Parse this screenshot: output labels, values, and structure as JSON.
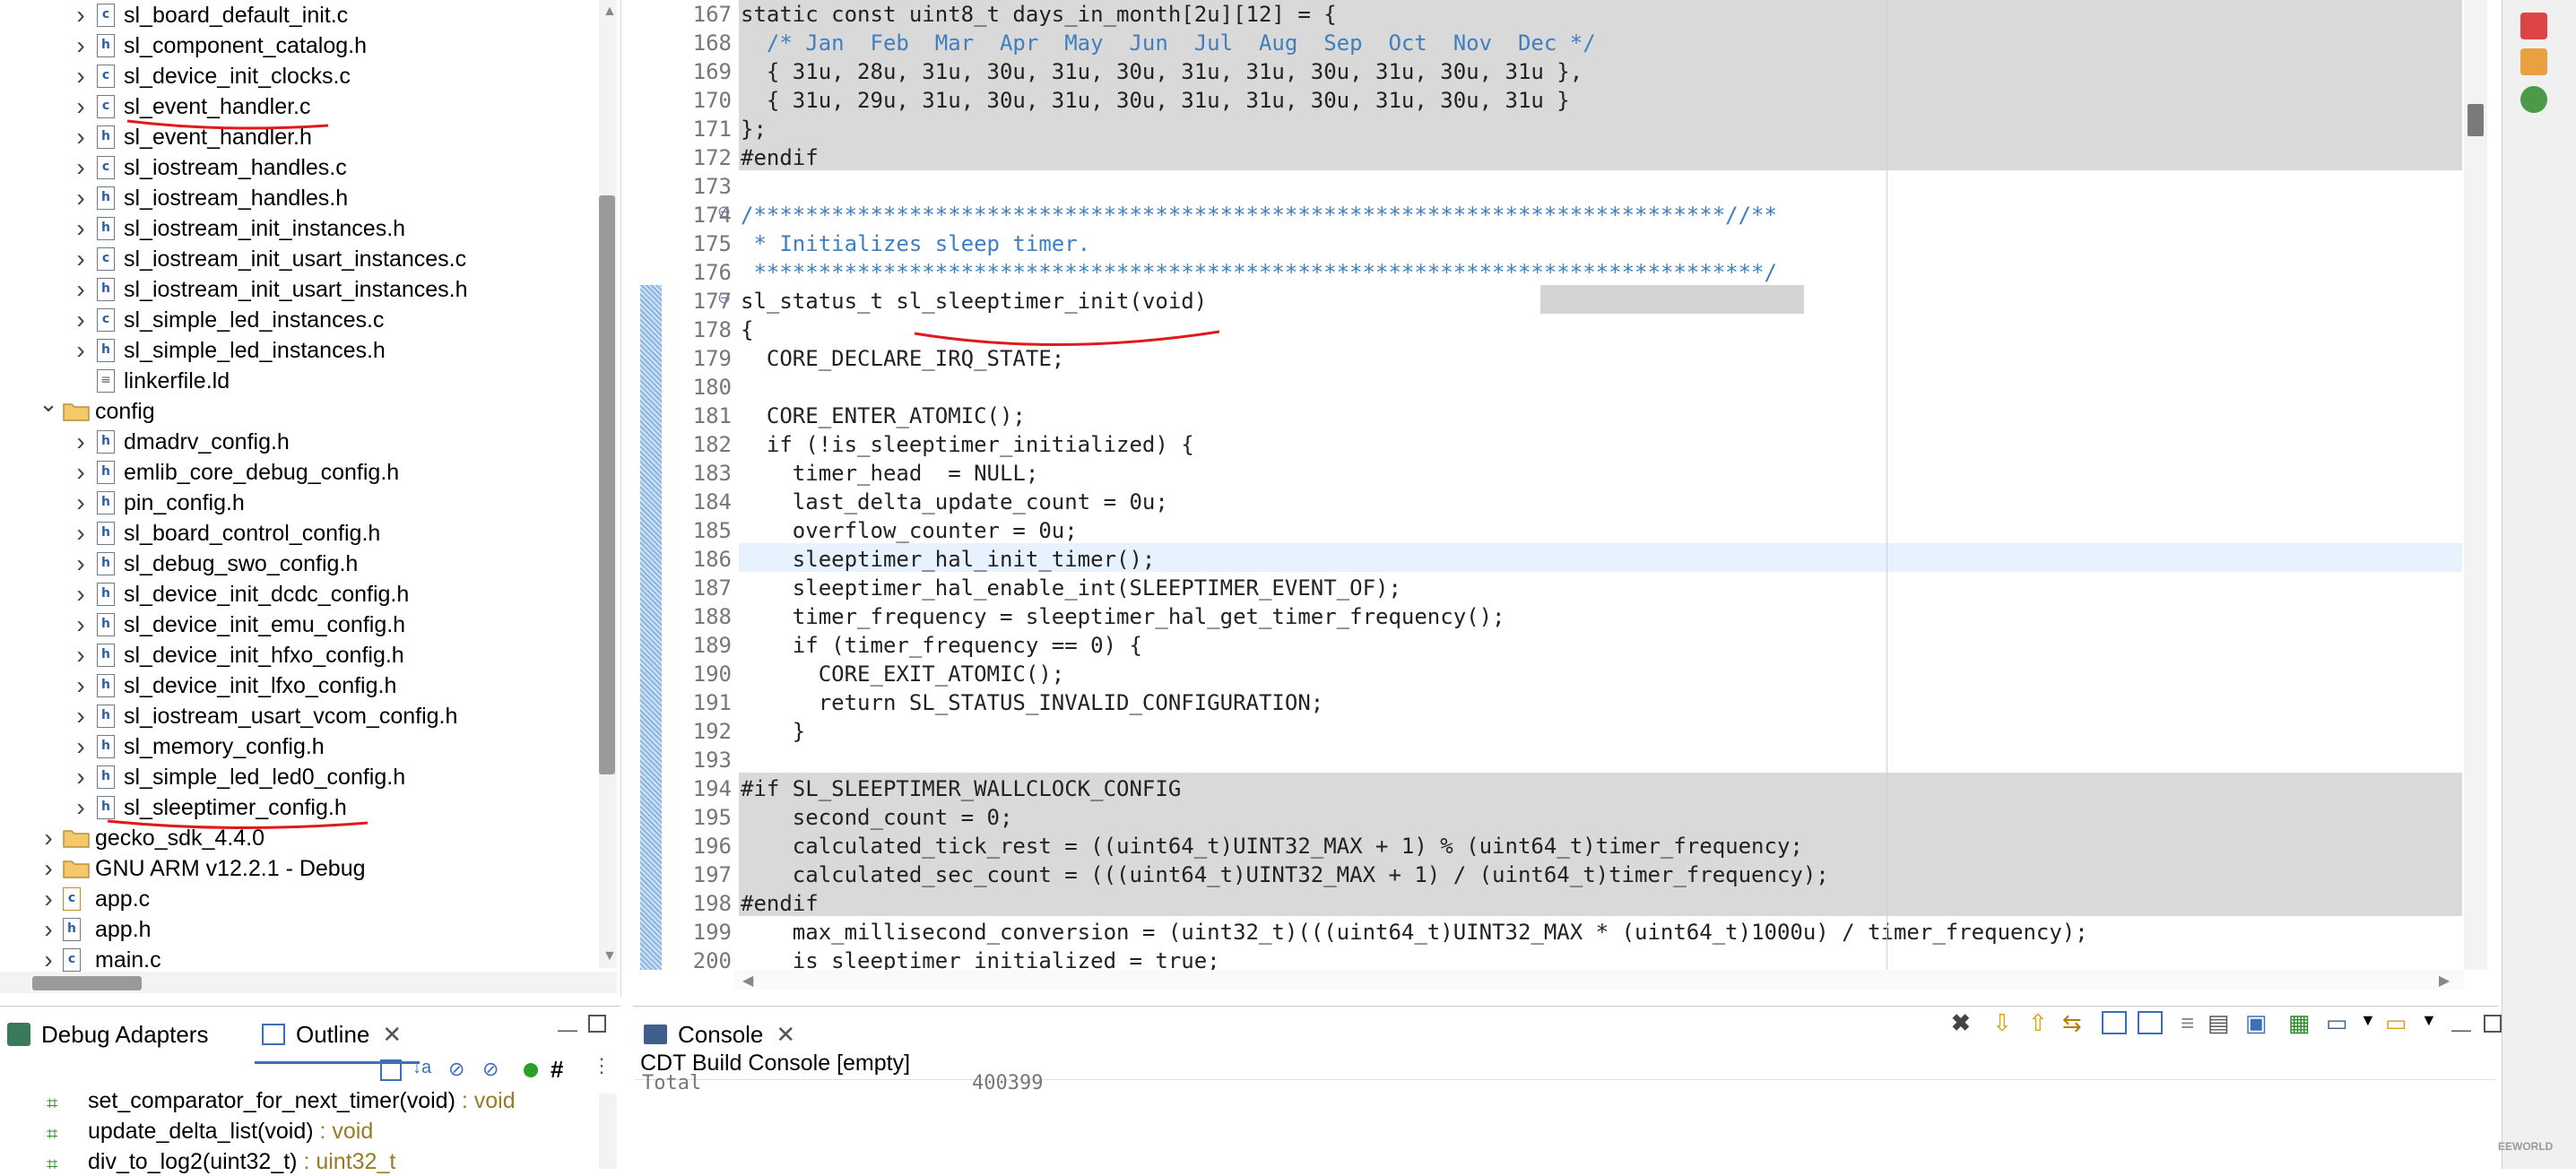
{
  "explorer": {
    "items": [
      {
        "label": "sl_board_default_init.c",
        "kind": "c",
        "level": 2
      },
      {
        "label": "sl_component_catalog.h",
        "kind": "h",
        "level": 2
      },
      {
        "label": "sl_device_init_clocks.c",
        "kind": "c",
        "level": 2
      },
      {
        "label": "sl_event_handler.c",
        "kind": "c",
        "level": 2
      },
      {
        "label": "sl_event_handler.h",
        "kind": "h",
        "level": 2
      },
      {
        "label": "sl_iostream_handles.c",
        "kind": "c",
        "level": 2
      },
      {
        "label": "sl_iostream_handles.h",
        "kind": "h",
        "level": 2
      },
      {
        "label": "sl_iostream_init_instances.h",
        "kind": "h",
        "level": 2
      },
      {
        "label": "sl_iostream_init_usart_instances.c",
        "kind": "c",
        "level": 2
      },
      {
        "label": "sl_iostream_init_usart_instances.h",
        "kind": "h",
        "level": 2
      },
      {
        "label": "sl_simple_led_instances.c",
        "kind": "c",
        "level": 2
      },
      {
        "label": "sl_simple_led_instances.h",
        "kind": "h",
        "level": 2
      },
      {
        "label": "linkerfile.ld",
        "kind": "ld",
        "level": 2
      },
      {
        "label": "config",
        "kind": "folder-open",
        "level": 1
      },
      {
        "label": "dmadrv_config.h",
        "kind": "h",
        "level": 2
      },
      {
        "label": "emlib_core_debug_config.h",
        "kind": "h",
        "level": 2
      },
      {
        "label": "pin_config.h",
        "kind": "h",
        "level": 2
      },
      {
        "label": "sl_board_control_config.h",
        "kind": "h",
        "level": 2
      },
      {
        "label": "sl_debug_swo_config.h",
        "kind": "h",
        "level": 2
      },
      {
        "label": "sl_device_init_dcdc_config.h",
        "kind": "h",
        "level": 2
      },
      {
        "label": "sl_device_init_emu_config.h",
        "kind": "h",
        "level": 2
      },
      {
        "label": "sl_device_init_hfxo_config.h",
        "kind": "h",
        "level": 2
      },
      {
        "label": "sl_device_init_lfxo_config.h",
        "kind": "h",
        "level": 2
      },
      {
        "label": "sl_iostream_usart_vcom_config.h",
        "kind": "h",
        "level": 2
      },
      {
        "label": "sl_memory_config.h",
        "kind": "h",
        "level": 2
      },
      {
        "label": "sl_simple_led_led0_config.h",
        "kind": "h",
        "level": 2
      },
      {
        "label": "sl_sleeptimer_config.h",
        "kind": "h",
        "level": 2
      },
      {
        "label": "gecko_sdk_4.4.0",
        "kind": "folder",
        "level": 0
      },
      {
        "label": "GNU ARM v12.2.1 - Debug",
        "kind": "folder",
        "level": 0
      },
      {
        "label": "app.c",
        "kind": "c-warn",
        "level": 0
      },
      {
        "label": "app.h",
        "kind": "h",
        "level": 0
      },
      {
        "label": "main.c",
        "kind": "c",
        "level": 0
      }
    ]
  },
  "editor": {
    "lines": [
      {
        "n": "167",
        "t": "static const uint8_t days_in_month[2u][12] = {"
      },
      {
        "n": "168",
        "t": "  /* Jan  Feb  Mar  Apr  May  Jun  Jul  Aug  Sep  Oct  Nov  Dec */"
      },
      {
        "n": "169",
        "t": "  { 31u, 28u, 31u, 30u, 31u, 30u, 31u, 31u, 30u, 31u, 30u, 31u },"
      },
      {
        "n": "170",
        "t": "  { 31u, 29u, 31u, 30u, 31u, 30u, 31u, 31u, 30u, 31u, 30u, 31u }"
      },
      {
        "n": "171",
        "t": "};"
      },
      {
        "n": "172",
        "t": "#endif"
      },
      {
        "n": "173",
        "t": ""
      },
      {
        "n": "174",
        "t": "/***************************************************************************//**"
      },
      {
        "n": "175",
        "t": " * Initializes sleep timer."
      },
      {
        "n": "176",
        "t": " ******************************************************************************/"
      },
      {
        "n": "177",
        "t": "sl_status_t sl_sleeptimer_init(void)"
      },
      {
        "n": "178",
        "t": "{"
      },
      {
        "n": "179",
        "t": "  CORE_DECLARE_IRQ_STATE;"
      },
      {
        "n": "180",
        "t": ""
      },
      {
        "n": "181",
        "t": "  CORE_ENTER_ATOMIC();"
      },
      {
        "n": "182",
        "t": "  if (!is_sleeptimer_initialized) {"
      },
      {
        "n": "183",
        "t": "    timer_head  = NULL;"
      },
      {
        "n": "184",
        "t": "    last_delta_update_count = 0u;"
      },
      {
        "n": "185",
        "t": "    overflow_counter = 0u;"
      },
      {
        "n": "186",
        "t": "    sleeptimer_hal_init_timer();"
      },
      {
        "n": "187",
        "t": "    sleeptimer_hal_enable_int(SLEEPTIMER_EVENT_OF);"
      },
      {
        "n": "188",
        "t": "    timer_frequency = sleeptimer_hal_get_timer_frequency();"
      },
      {
        "n": "189",
        "t": "    if (timer_frequency == 0) {"
      },
      {
        "n": "190",
        "t": "      CORE_EXIT_ATOMIC();"
      },
      {
        "n": "191",
        "t": "      return SL_STATUS_INVALID_CONFIGURATION;"
      },
      {
        "n": "192",
        "t": "    }"
      },
      {
        "n": "193",
        "t": ""
      },
      {
        "n": "194",
        "t": "#if SL_SLEEPTIMER_WALLCLOCK_CONFIG"
      },
      {
        "n": "195",
        "t": "    second_count = 0;"
      },
      {
        "n": "196",
        "t": "    calculated_tick_rest = ((uint64_t)UINT32_MAX + 1) % (uint64_t)timer_frequency;"
      },
      {
        "n": "197",
        "t": "    calculated_sec_count = (((uint64_t)UINT32_MAX + 1) / (uint64_t)timer_frequency);"
      },
      {
        "n": "198",
        "t": "#endif"
      },
      {
        "n": "199",
        "t": "    max_millisecond_conversion = (uint32_t)(((uint64_t)UINT32_MAX * (uint64_t)1000u) / timer_frequency);"
      },
      {
        "n": "200",
        "t": "    is_sleeptimer_initialized = true;"
      }
    ]
  },
  "outline": {
    "tabs": [
      {
        "label": "Debug Adapters"
      },
      {
        "label": "Outline"
      }
    ],
    "items": [
      {
        "name": "set_comparator_for_next_timer(void)",
        "type": " : void"
      },
      {
        "name": "update_delta_list(void)",
        "type": " : void"
      },
      {
        "name": "div_to_log2(uint32_t)",
        "type": " : uint32_t"
      }
    ]
  },
  "console": {
    "tab": "Console",
    "title": "CDT Build Console [empty]",
    "partial_line_left": "Total",
    "partial_line_right": "400399"
  },
  "watermark": "EEWORLD"
}
